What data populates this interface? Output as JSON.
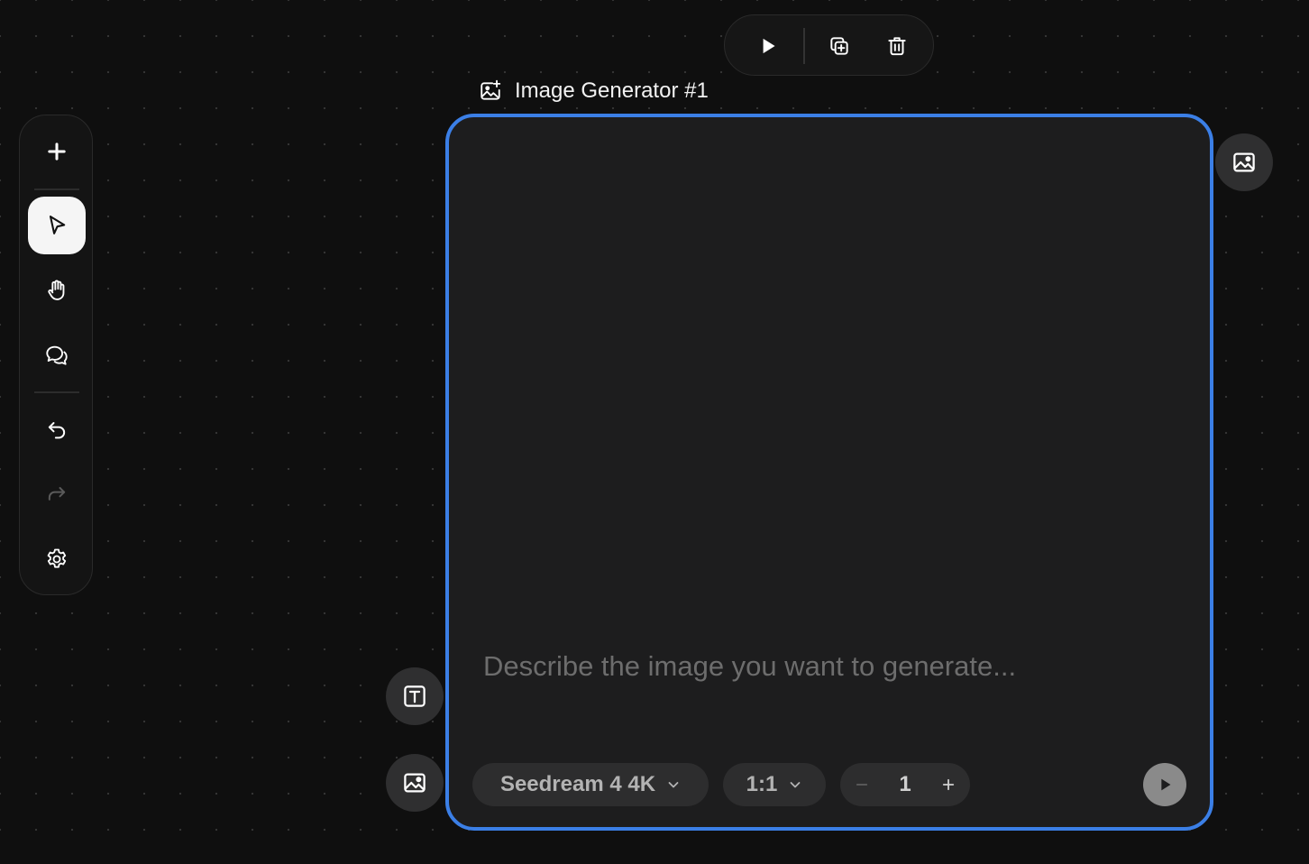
{
  "colors": {
    "background": "#0f0f0f",
    "card": "#1d1d1e",
    "selection_border": "#3b7fe6",
    "pill": "#2d2d2e",
    "run_button": "#8a8a8a"
  },
  "left_toolbar": {
    "tools": [
      {
        "icon": "plus-icon",
        "state": "default"
      },
      {
        "icon": "cursor-pointer-icon",
        "state": "active"
      },
      {
        "icon": "hand-icon",
        "state": "default"
      },
      {
        "icon": "comment-icon",
        "state": "default"
      },
      {
        "icon": "undo-icon",
        "state": "default"
      },
      {
        "icon": "redo-icon",
        "state": "disabled"
      },
      {
        "icon": "settings-icon",
        "state": "default"
      }
    ]
  },
  "node_toolbar": {
    "actions": [
      "play-icon",
      "duplicate-icon",
      "trash-icon"
    ]
  },
  "node": {
    "title": "Image Generator #1",
    "title_icon": "image-sparkle-icon",
    "prompt": {
      "value": "",
      "placeholder": "Describe the image you want to generate..."
    },
    "model_label": "Seedream 4 4K",
    "aspect_ratio": "1:1",
    "count": "1",
    "output_handle_icon": "image-icon",
    "input_handles": [
      "text-icon",
      "image-icon"
    ]
  }
}
